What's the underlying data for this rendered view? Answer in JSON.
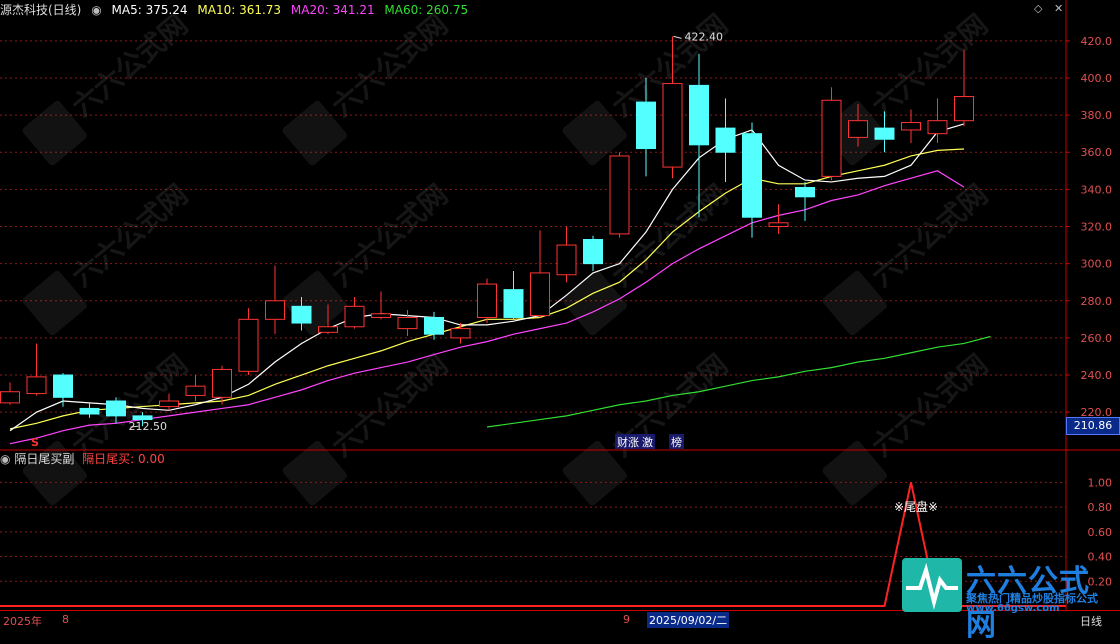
{
  "header": {
    "stock_name": "源杰科技(日线)",
    "ma5": "MA5: 375.24",
    "ma10": "MA10: 361.73",
    "ma20": "MA20: 341.21",
    "ma60": "MA60: 260.75"
  },
  "price_axis": {
    "ticks": [
      "420.0",
      "400.0",
      "380.0",
      "360.0",
      "340.0",
      "320.0",
      "300.0",
      "280.0",
      "260.0",
      "240.0",
      "220.0"
    ],
    "current_label": "210.86"
  },
  "annotations": {
    "high_label": "422.40",
    "low_label": "212.50",
    "marker_s": "S",
    "marker_cai": "财涨",
    "marker_ji": "激",
    "marker_bang": "榜",
    "tail_label": "※尾盘※"
  },
  "indicator": {
    "name": "隔日尾买副",
    "value": "隔日尾买: 0.00",
    "ticks": [
      "1.00",
      "0.80",
      "0.60",
      "0.40",
      "0.20"
    ]
  },
  "bottom": {
    "year": "2025年",
    "month8": "8",
    "month9": "9",
    "cursor_date": "2025/09/02/二",
    "period": "日线"
  },
  "watermark": {
    "brand": "六六公式网",
    "slogan": "聚焦热门精品炒股指标公式",
    "url": "www.66gsw.com"
  },
  "colors": {
    "up": "#ff3333",
    "down": "#54ffff",
    "ma5": "#ffffff",
    "ma10": "#ffff55",
    "ma20": "#ff44ff",
    "ma60": "#33dd33"
  },
  "chart_data": {
    "type": "candlestick",
    "candles": [
      {
        "o": 225,
        "c": 231,
        "h": 236,
        "l": 224
      },
      {
        "o": 230,
        "c": 239,
        "h": 257,
        "l": 229
      },
      {
        "o": 240,
        "c": 228,
        "h": 241,
        "l": 223
      },
      {
        "o": 222,
        "c": 219,
        "h": 225,
        "l": 217
      },
      {
        "o": 226,
        "c": 218,
        "h": 228,
        "l": 214
      },
      {
        "o": 218,
        "c": 216,
        "h": 220,
        "l": 212.5
      },
      {
        "o": 223,
        "c": 226,
        "h": 230,
        "l": 221
      },
      {
        "o": 229,
        "c": 234,
        "h": 240,
        "l": 226
      },
      {
        "o": 228,
        "c": 243,
        "h": 245,
        "l": 224
      },
      {
        "o": 242,
        "c": 270,
        "h": 276,
        "l": 240
      },
      {
        "o": 270,
        "c": 280,
        "h": 299,
        "l": 262
      },
      {
        "o": 277,
        "c": 268,
        "h": 282,
        "l": 264
      },
      {
        "o": 263,
        "c": 266,
        "h": 278,
        "l": 262
      },
      {
        "o": 266,
        "c": 277,
        "h": 282,
        "l": 265
      },
      {
        "o": 271,
        "c": 273,
        "h": 285,
        "l": 270
      },
      {
        "o": 265,
        "c": 271,
        "h": 275,
        "l": 261
      },
      {
        "o": 271,
        "c": 262,
        "h": 274,
        "l": 259
      },
      {
        "o": 260,
        "c": 265,
        "h": 268,
        "l": 257
      },
      {
        "o": 271,
        "c": 289,
        "h": 292,
        "l": 268
      },
      {
        "o": 286,
        "c": 271,
        "h": 296,
        "l": 270
      },
      {
        "o": 272,
        "c": 295,
        "h": 318,
        "l": 271
      },
      {
        "o": 294,
        "c": 310,
        "h": 320,
        "l": 290
      },
      {
        "o": 313,
        "c": 300,
        "h": 315,
        "l": 296
      },
      {
        "o": 316,
        "c": 358,
        "h": 360,
        "l": 314
      },
      {
        "o": 387,
        "c": 362,
        "h": 400,
        "l": 347
      },
      {
        "o": 352,
        "c": 397,
        "h": 422.4,
        "l": 346
      },
      {
        "o": 396,
        "c": 364,
        "h": 413,
        "l": 325
      },
      {
        "o": 373,
        "c": 360,
        "h": 389,
        "l": 344
      },
      {
        "o": 370,
        "c": 325,
        "h": 376,
        "l": 314
      },
      {
        "o": 320,
        "c": 322,
        "h": 332,
        "l": 316
      },
      {
        "o": 341,
        "c": 336,
        "h": 344,
        "l": 323
      },
      {
        "o": 347,
        "c": 388,
        "h": 395,
        "l": 345
      },
      {
        "o": 368,
        "c": 377,
        "h": 386,
        "l": 363
      },
      {
        "o": 373,
        "c": 367,
        "h": 382,
        "l": 360
      },
      {
        "o": 372,
        "c": 376,
        "h": 383,
        "l": 365
      },
      {
        "o": 370,
        "c": 377,
        "h": 389,
        "l": 365
      },
      {
        "o": 377,
        "c": 390,
        "h": 415,
        "l": 374
      }
    ],
    "ma5": [
      210,
      220,
      226,
      225,
      224,
      222,
      221,
      224,
      228,
      235,
      247,
      257,
      265,
      271,
      273,
      272,
      271,
      267,
      267,
      269,
      272,
      283,
      295,
      300,
      317,
      340,
      357,
      367,
      372,
      353,
      345,
      344,
      346,
      347,
      353,
      371,
      375.24
    ],
    "ma10": [
      211,
      214,
      218,
      221,
      222,
      223,
      224,
      225,
      226,
      229,
      235,
      240,
      245,
      249,
      253,
      258,
      262,
      266,
      270,
      270,
      271,
      276,
      284,
      290,
      302,
      317,
      328,
      338,
      346,
      343,
      343,
      347,
      350,
      353,
      358,
      361,
      361.73
    ],
    "ma20": [
      203,
      206,
      210,
      213,
      214,
      216,
      218,
      220,
      222,
      224,
      228,
      232,
      237,
      241,
      244,
      247,
      251,
      255,
      258,
      262,
      265,
      268,
      274,
      281,
      290,
      300,
      308,
      315,
      322,
      326,
      329,
      334,
      337,
      342,
      346,
      350,
      341.21
    ],
    "ma60": [
      212,
      214,
      216,
      218,
      221,
      224,
      226,
      229,
      231,
      234,
      237,
      239,
      242,
      244,
      247,
      249,
      252,
      255,
      257,
      260.75
    ],
    "ma60_start_index": 18,
    "ylim": [
      205,
      428
    ],
    "indicator_values": [
      0,
      0,
      0,
      0,
      0,
      0,
      0,
      0,
      0,
      0,
      0,
      0,
      0,
      0,
      0,
      0,
      0,
      0,
      0,
      0,
      0,
      0,
      0,
      0,
      0,
      0,
      0,
      0,
      0,
      0,
      0,
      0,
      0,
      0,
      1,
      0,
      0
    ],
    "indicator_ylim": [
      0,
      1.1
    ]
  }
}
